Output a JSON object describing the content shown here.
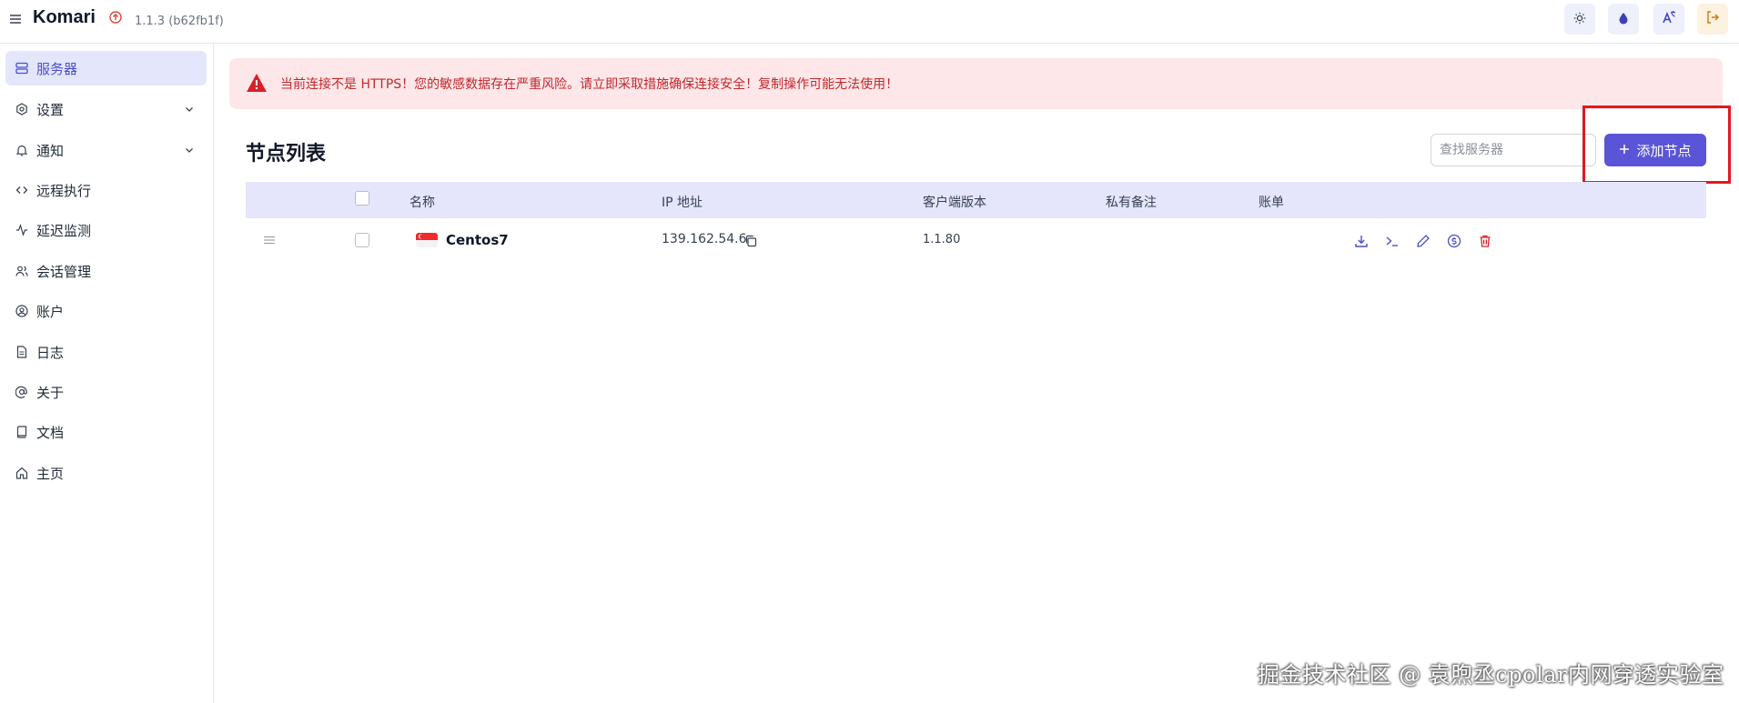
{
  "header": {
    "app_title": "Komari",
    "version": "1.1.3 (b62fb1f)",
    "icons": [
      "menu-icon",
      "update-icon",
      "sun-icon",
      "droplet-icon",
      "translate-icon",
      "logout-icon"
    ]
  },
  "sidebar": {
    "items": [
      {
        "label": "服务器",
        "icon": "server-icon",
        "active": true
      },
      {
        "label": "设置",
        "icon": "settings-icon",
        "expandable": true
      },
      {
        "label": "通知",
        "icon": "bell-icon",
        "expandable": true
      },
      {
        "label": "远程执行",
        "icon": "code-icon"
      },
      {
        "label": "延迟监测",
        "icon": "activity-icon"
      },
      {
        "label": "会话管理",
        "icon": "users-icon"
      },
      {
        "label": "账户",
        "icon": "user-circle-icon"
      },
      {
        "label": "日志",
        "icon": "file-text-icon"
      },
      {
        "label": "关于",
        "icon": "at-sign-icon"
      },
      {
        "label": "文档",
        "icon": "book-icon"
      },
      {
        "label": "主页",
        "icon": "home-icon"
      }
    ]
  },
  "alert": {
    "text": "当前连接不是 HTTPS！您的敏感数据存在严重风险。请立即采取措施确保连接安全！复制操作可能无法使用！"
  },
  "main": {
    "title": "节点列表",
    "search_placeholder": "查找服务器",
    "add_button": "添加节点"
  },
  "table": {
    "columns": [
      "名称",
      "IP 地址",
      "客户端版本",
      "私有备注",
      "账单"
    ],
    "rows": [
      {
        "name": "Centos7",
        "flag": "SG",
        "ip": "139.162.54.6",
        "client_version": "1.1.80",
        "note": "",
        "billing": ""
      }
    ],
    "row_actions": [
      "download-icon",
      "terminal-icon",
      "edit-icon",
      "dollar-icon",
      "trash-icon"
    ]
  },
  "watermark": "掘金技术社区 @ 袁煦丞cpolar内网穿透实验室",
  "colors": {
    "accent": "#5a55d6",
    "active_bg": "#e4e6fb",
    "alert_bg": "#fde7e8",
    "alert_text": "#c1272d",
    "highlight": "#e0191f"
  }
}
